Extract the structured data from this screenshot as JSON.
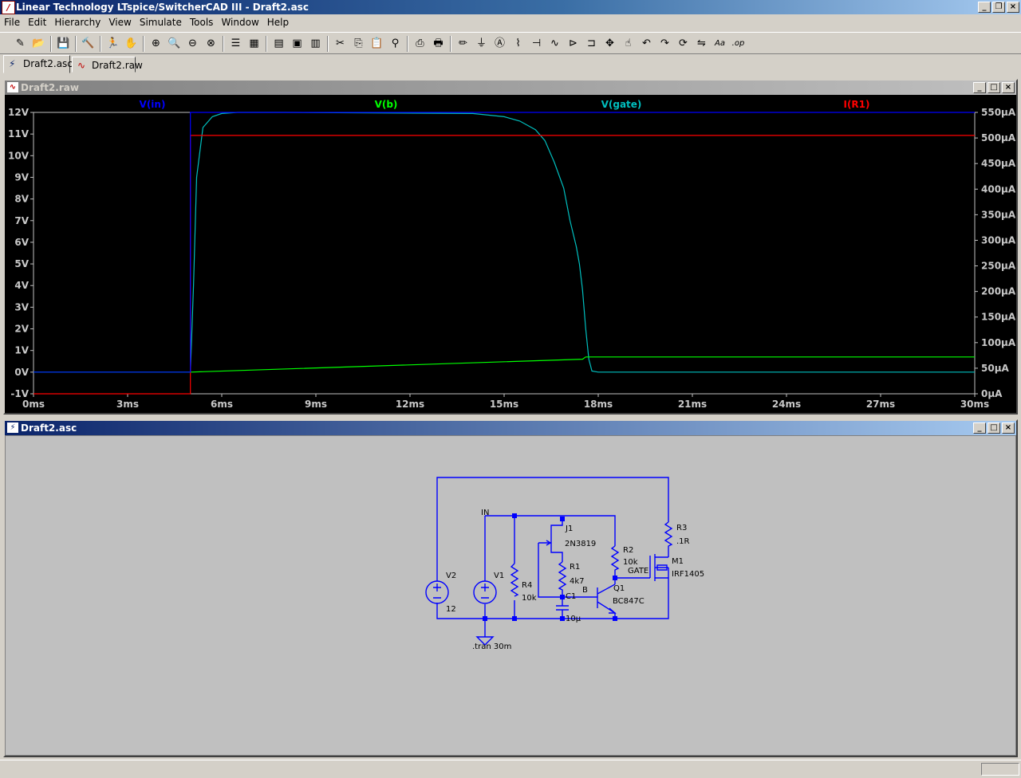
{
  "app": {
    "title": "Linear Technology LTspice/SwitcherCAD III - Draft2.asc",
    "icon_name": "ltspice-logo-icon"
  },
  "menu": [
    "File",
    "Edit",
    "Hierarchy",
    "View",
    "Simulate",
    "Tools",
    "Window",
    "Help"
  ],
  "toolbar": {
    "icons": [
      "new-schematic-icon",
      "open-icon",
      "|",
      "save-icon",
      "|",
      "control-panel-icon",
      "|",
      "run-icon",
      "pan-icon",
      "|",
      "zoom-in-icon",
      "zoom-area-icon",
      "zoom-out-icon",
      "zoom-fit-icon",
      "|",
      "autorange-icon",
      "grid-icon",
      "|",
      "tile-horizontal-icon",
      "cascade-icon",
      "close-all-icon",
      "|",
      "cut-icon",
      "copy-icon",
      "paste-icon",
      "find-icon",
      "|",
      "print-preview-icon",
      "print-icon",
      "|",
      "wire-icon",
      "ground-icon",
      "label-icon",
      "resistor-icon",
      "capacitor-icon",
      "inductor-icon",
      "diode-icon",
      "component-icon",
      "move-icon",
      "drag-icon",
      "undo-icon",
      "redo-icon",
      "rotate-icon",
      "mirror-icon",
      "text-icon",
      "spice-directive-icon"
    ]
  },
  "tabs": [
    {
      "label": "Draft2.asc",
      "icon": "schematic-tab-icon"
    },
    {
      "label": "Draft2.raw",
      "icon": "waveform-tab-icon"
    }
  ],
  "waveform_window": {
    "title": "Draft2.raw",
    "icon": "waveform-icon"
  },
  "schematic_window": {
    "title": "Draft2.asc",
    "icon": "schematic-icon"
  },
  "colors": {
    "vin": "#0000ff",
    "vb": "#00ff00",
    "vgate": "#00bfbf",
    "ir1": "#ff0000",
    "plot_bg": "#000000",
    "axis_text": "#c8c8c8",
    "wire": "#0000ff",
    "schematic_bg": "#c0c0c0"
  },
  "chart_data": {
    "type": "line",
    "title": "",
    "xlabel": "",
    "x_ticks": [
      "0ms",
      "3ms",
      "6ms",
      "9ms",
      "12ms",
      "15ms",
      "18ms",
      "21ms",
      "24ms",
      "27ms",
      "30ms"
    ],
    "xlim": [
      0,
      30
    ],
    "ylabel_left": "",
    "ylim_left": [
      -1,
      12
    ],
    "yticks_left": [
      "12V",
      "11V",
      "10V",
      "9V",
      "8V",
      "7V",
      "6V",
      "5V",
      "4V",
      "3V",
      "2V",
      "1V",
      "0V",
      "-1V"
    ],
    "ylabel_right": "",
    "ylim_right": [
      0,
      550
    ],
    "yticks_right": [
      "550µA",
      "500µA",
      "450µA",
      "400µA",
      "350µA",
      "300µA",
      "250µA",
      "200µA",
      "150µA",
      "100µA",
      "50µA",
      "0µA"
    ],
    "grid": false,
    "series": [
      {
        "name": "V(in)",
        "axis": "left",
        "x": [
          0,
          5.0,
          5.0,
          30
        ],
        "y": [
          0,
          0,
          12,
          12
        ]
      },
      {
        "name": "V(b)",
        "axis": "left",
        "x": [
          0,
          5.0,
          17.5,
          17.6,
          30
        ],
        "y": [
          0,
          0,
          0.6,
          0.7,
          0.7
        ]
      },
      {
        "name": "V(gate)",
        "axis": "left",
        "x": [
          0,
          5.0,
          5.1,
          5.2,
          5.4,
          5.7,
          6.0,
          6.5,
          8,
          14,
          15,
          15.5,
          16,
          16.3,
          16.6,
          16.9,
          17.1,
          17.3,
          17.4,
          17.5,
          17.6,
          17.7,
          17.8,
          18,
          30
        ],
        "y": [
          0,
          0,
          4,
          9,
          11.3,
          11.8,
          11.95,
          12,
          12,
          11.95,
          11.8,
          11.6,
          11.2,
          10.7,
          9.7,
          8.5,
          7,
          5.8,
          5,
          3.8,
          2,
          0.6,
          0.05,
          0,
          0
        ]
      },
      {
        "name": "I(R1)",
        "axis": "right",
        "x": [
          0,
          5.0,
          5.0,
          30
        ],
        "y": [
          0,
          0,
          505,
          505
        ]
      }
    ]
  },
  "schematic": {
    "labels": {
      "in": "IN",
      "v2_name": "V2",
      "v2_value": "12",
      "v1_name": "V1",
      "r4_name": "R4",
      "r4_value": "10k",
      "j1_name": "J1",
      "j1_value": "2N3819",
      "r1_name": "R1",
      "r1_value": "4k7",
      "c1_name": "C1",
      "c1_value": "10µ",
      "b_label": "B",
      "q1_name": "Q1",
      "q1_value": "BC847C",
      "r2_name": "R2",
      "r2_value": "10k",
      "gate_label": "GATE",
      "m1_name": "M1",
      "m1_value": "IRF1405",
      "r3_name": "R3",
      "r3_value": ".1R",
      "tran": ".tran 30m"
    }
  }
}
